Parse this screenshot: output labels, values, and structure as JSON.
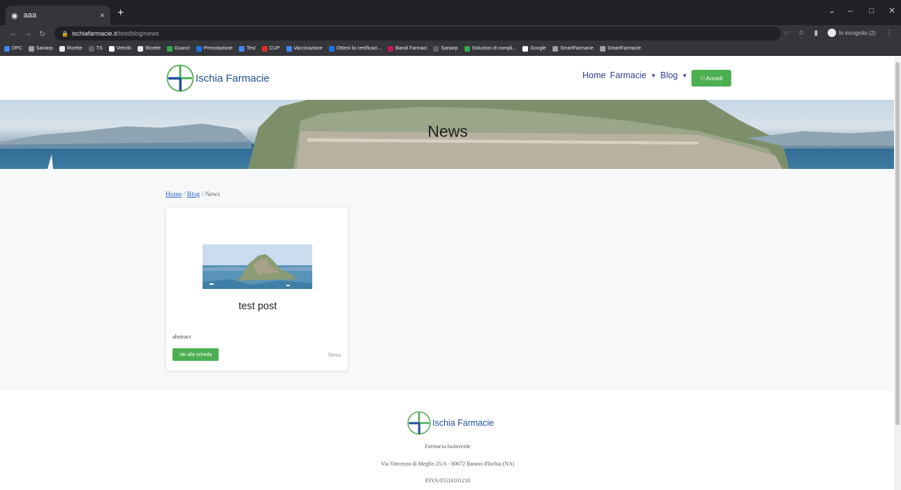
{
  "browser": {
    "tab_title": "aaa",
    "tab_close": "×",
    "new_tab": "+",
    "url_host": "ischiafarmacie.it",
    "url_path": "/test/blog/news",
    "incognito_label": "In incognito (2)",
    "bookmarks": [
      {
        "label": "DPC",
        "color": "#4285f4"
      },
      {
        "label": "Saniarp",
        "color": "#9aa0a6"
      },
      {
        "label": "Ricette",
        "color": "#e8eaed"
      },
      {
        "label": "TS",
        "color": "#5f6368"
      },
      {
        "label": "Vetinfo",
        "color": "#ffffff"
      },
      {
        "label": "Ricette",
        "color": "#e8eaed"
      },
      {
        "label": "Guacci",
        "color": "#34a853"
      },
      {
        "label": "Prenotazione",
        "color": "#1a73e8"
      },
      {
        "label": "Test",
        "color": "#4285f4"
      },
      {
        "label": "CUP",
        "color": "#d93025"
      },
      {
        "label": "Vaccinazione",
        "color": "#4285f4"
      },
      {
        "label": "Ottieni la certificazi...",
        "color": "#1a73e8"
      },
      {
        "label": "Bandi Farmaci",
        "color": "#c2185b"
      },
      {
        "label": "Saniarp",
        "color": "#5f6368"
      },
      {
        "label": "Soluzioni di compli...",
        "color": "#34a853"
      },
      {
        "label": "Google",
        "color": "#ffffff"
      },
      {
        "label": "SmartFarmacie",
        "color": "#9aa0a6"
      },
      {
        "label": "SmartFarmacie",
        "color": "#9aa0a6"
      }
    ]
  },
  "site": {
    "brand": "Ischia Farmacie",
    "nav": {
      "home": "Home",
      "farmacie": "Farmacie",
      "blog": "Blog",
      "login": "Accedi"
    },
    "hero_title": "News",
    "breadcrumb": {
      "home": "Home",
      "sep1": "/",
      "blog": "Blog",
      "sep2": "/",
      "current": "News"
    },
    "card": {
      "title": "test post",
      "abstract": "abstract",
      "button": "Vai alla scheda",
      "category": "News"
    },
    "footer": {
      "brand": "Ischia Farmacie",
      "pharmacy_name": "Farmacia Isolaverde",
      "address": "Via Vincenzo di Meglio 25/A - 80072 Barano d'Ischia (NA)",
      "vat": "P.IVA 05514101210"
    }
  },
  "colors": {
    "accent_green": "#4caf50",
    "brand_blue": "#1e4e9c"
  }
}
